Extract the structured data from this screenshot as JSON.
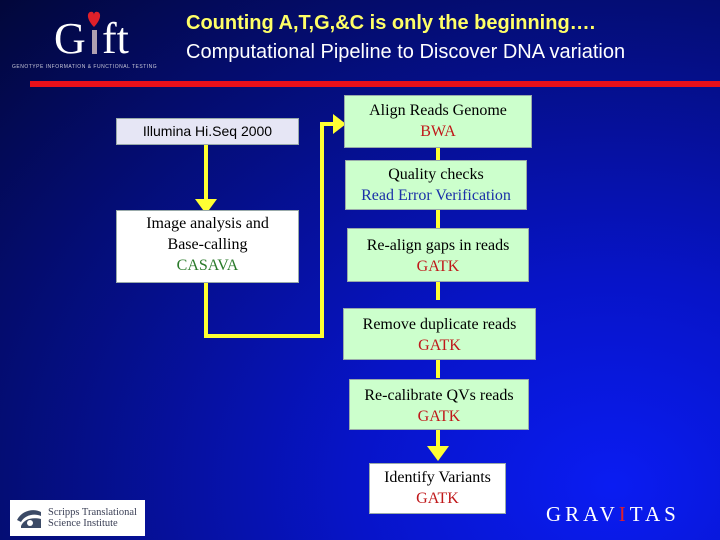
{
  "header": {
    "logo_text": "Gift",
    "logo_tagline": "GENOTYPE INFORMATION & FUNCTIONAL TESTING",
    "title_line1": "Counting A,T,G,&C is only the beginning….",
    "title_line2": "Computational Pipeline to Discover DNA variation"
  },
  "colors": {
    "title_highlight": "#ffff66",
    "divider": "#e8101a",
    "connector": "#ffff33",
    "tool_red": "#c0181a",
    "tool_blue": "#1a30a8",
    "tool_green": "#2a7a2a",
    "step_box": "#ccffcc"
  },
  "left_steps": [
    {
      "label": "Illumina Hi.Seq 2000"
    },
    {
      "label_line1": "Image analysis and",
      "label_line2": "Base-calling",
      "tool": "CASAVA"
    }
  ],
  "pipeline": [
    {
      "label": "Align Reads Genome",
      "tool": "BWA"
    },
    {
      "label": "Quality checks",
      "tool": "Read Error Verification"
    },
    {
      "label": "Re-align gaps in reads",
      "tool": "GATK"
    },
    {
      "label": "Remove duplicate reads",
      "tool": "GATK"
    },
    {
      "label": "Re-calibrate QVs reads",
      "tool": "GATK"
    },
    {
      "label": "Identify Variants",
      "tool": "GATK"
    }
  ],
  "footer": {
    "scripps_line1": "Scripps Translational",
    "scripps_line2": "Science Institute",
    "gravitas_pre": "GRAV",
    "gravitas_mid": "I",
    "gravitas_post": "TAS"
  }
}
